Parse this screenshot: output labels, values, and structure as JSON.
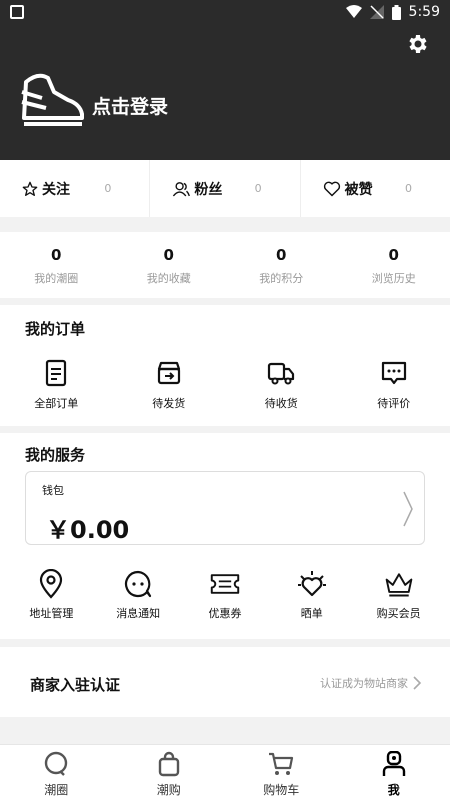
{
  "status_bar": {
    "time": "5:59"
  },
  "header": {
    "login_text": "点击登录"
  },
  "social": [
    {
      "label": "关注",
      "count": "0"
    },
    {
      "label": "粉丝",
      "count": "0"
    },
    {
      "label": "被赞",
      "count": "0"
    }
  ],
  "stats": [
    {
      "value": "0",
      "label": "我的潮圈"
    },
    {
      "value": "0",
      "label": "我的收藏"
    },
    {
      "value": "0",
      "label": "我的积分"
    },
    {
      "value": "0",
      "label": "浏览历史"
    }
  ],
  "orders": {
    "title": "我的订单",
    "items": [
      {
        "label": "全部订单",
        "icon": "document-icon"
      },
      {
        "label": "待发货",
        "icon": "box-icon"
      },
      {
        "label": "待收货",
        "icon": "truck-icon"
      },
      {
        "label": "待评价",
        "icon": "comment-icon"
      }
    ]
  },
  "services": {
    "title": "我的服务",
    "wallet_label": "钱包",
    "wallet_amount": "￥0.00",
    "items": [
      {
        "label": "地址管理",
        "icon": "location-pin-icon"
      },
      {
        "label": "消息通知",
        "icon": "message-icon"
      },
      {
        "label": "优惠券",
        "icon": "ticket-icon"
      },
      {
        "label": "晒单",
        "icon": "sun-heart-icon"
      },
      {
        "label": "购买会员",
        "icon": "crown-icon"
      }
    ]
  },
  "merchant": {
    "title": "商家入驻认证",
    "link": "认证成为物站商家"
  },
  "tabs": [
    {
      "label": "潮圈",
      "icon": "circle-icon"
    },
    {
      "label": "潮购",
      "icon": "bag-icon"
    },
    {
      "label": "购物车",
      "icon": "cart-icon"
    },
    {
      "label": "我",
      "icon": "profile-icon",
      "active": true
    }
  ]
}
